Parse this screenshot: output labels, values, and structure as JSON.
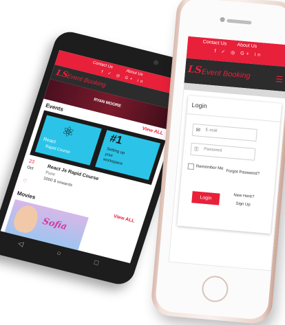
{
  "iphone": {
    "top_links": {
      "contact": "Contact Us",
      "about": "About Us"
    },
    "social_icons": "f ✓ ◎ G+ in",
    "brand": {
      "logo": "LS",
      "name": "Event Booking"
    },
    "login": {
      "title": "Login",
      "email_placeholder": "E-mail",
      "password_placeholder": "Password",
      "remember_label": "Remember Me",
      "forgot_label": "Forgot Password?",
      "login_button": "Login",
      "new_here": "New Here?",
      "signup": "Sign Up"
    }
  },
  "android": {
    "top_links": {
      "contact": "Contact Us",
      "about": "About Us"
    },
    "social_icons": "f ✓ ◎ G+ in",
    "brand": {
      "logo": "LS",
      "name": "Event Booking"
    },
    "banner_text": "RYAN MOORE",
    "events": {
      "title": "Events",
      "view_all": "View ALL",
      "card": {
        "react_title": "React",
        "react_sub": "Rapid Course",
        "tip_number": "#1",
        "tip_line1": "Setting up",
        "tip_line2": "your",
        "tip_line3": "workspace"
      },
      "item": {
        "date": "23",
        "month": "Oct",
        "year": "",
        "name": "React Js Rapid Course",
        "place": "Pune",
        "price": "5000 $ onwards"
      }
    },
    "movies": {
      "title": "Movies",
      "view_all": "View ALL",
      "poster_title": "Sofia"
    }
  },
  "colors": {
    "accent": "#e8203a",
    "dark": "#2c2c2c",
    "react": "#2bc4e8"
  }
}
